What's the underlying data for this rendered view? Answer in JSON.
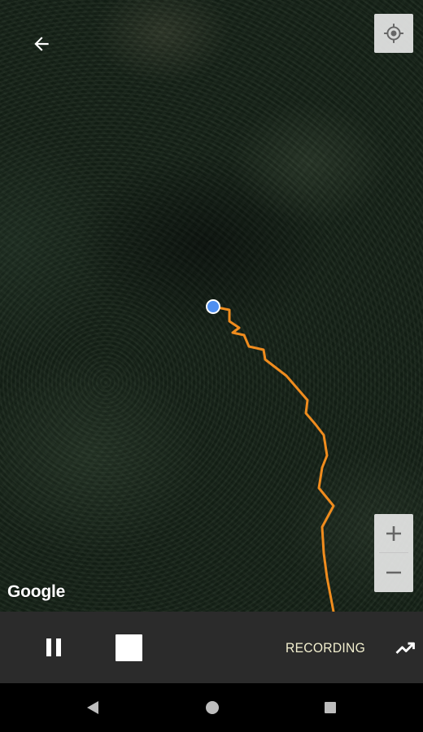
{
  "map": {
    "attribution": "Google",
    "track_color": "#f08c1e",
    "location_dot_color": "#4f8ff0"
  },
  "header": {
    "back_icon": "arrow-left-icon",
    "locate_icon": "my-location-icon"
  },
  "zoom": {
    "in_label": "+",
    "out_label": "−"
  },
  "controls": {
    "pause_icon": "pause-icon",
    "stop_icon": "stop-icon",
    "status": "RECORDING",
    "stats_icon": "trending-up-icon",
    "status_color": "#f2efcf"
  },
  "navbar": {
    "back_icon": "nav-back-icon",
    "home_icon": "nav-home-icon",
    "recents_icon": "nav-recents-icon"
  }
}
